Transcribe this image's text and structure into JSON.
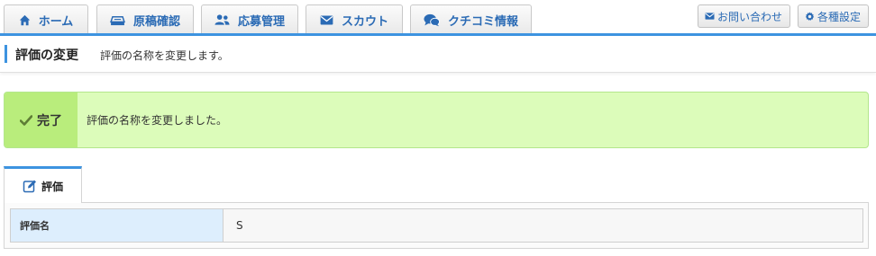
{
  "nav": {
    "tabs": [
      {
        "label": "ホーム",
        "icon": "home-icon"
      },
      {
        "label": "原稿確認",
        "icon": "documents-icon"
      },
      {
        "label": "応募管理",
        "icon": "users-icon"
      },
      {
        "label": "スカウト",
        "icon": "mail-icon"
      },
      {
        "label": "クチコミ情報",
        "icon": "chat-bubbles-icon"
      }
    ],
    "contact_label": "お問い合わせ",
    "settings_label": "各種設定"
  },
  "header": {
    "title": "評価の変更",
    "description": "評価の名称を変更します。"
  },
  "alert": {
    "label": "完了",
    "message": "評価の名称を変更しました。"
  },
  "panel": {
    "tab_label": "評価",
    "rows": [
      {
        "label": "評価名",
        "value": "S"
      }
    ]
  },
  "colors": {
    "accent": "#3d93e0",
    "link": "#2b6bb5",
    "success_bg": "#dcfcba",
    "success_label_bg": "#b9ed7c",
    "header_cell_bg": "#ddeefd"
  }
}
